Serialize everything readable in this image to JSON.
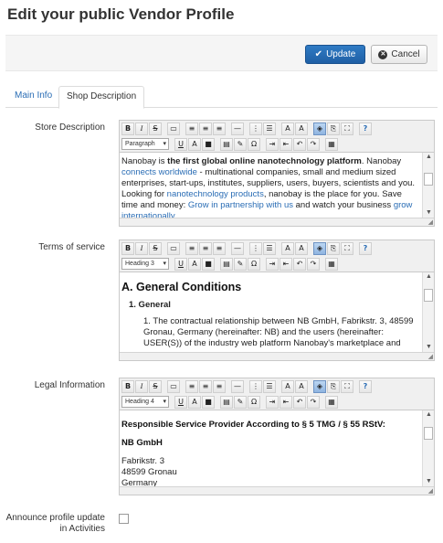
{
  "page": {
    "title": "Edit your public Vendor Profile"
  },
  "actions": {
    "update_label": "Update",
    "cancel_label": "Cancel"
  },
  "tabs": [
    {
      "label": "Main Info"
    },
    {
      "label": "Shop Description"
    }
  ],
  "fields": {
    "store_description": {
      "label": "Store Description",
      "format": "Paragraph",
      "text": {
        "p1_a": "Nanobay is ",
        "p1_b": "the first global online nanotechnology platform",
        "p1_c": ". Nanobay ",
        "link1": "connects worldwide",
        "p1_d": " - multinational companies, small and medium sized enterprises, start-ups, institutes, suppliers, users, buyers, scientists and you. Looking for ",
        "link2": "nanotechnology products",
        "p1_e": ", nanobay is the place for you. Save time and money: ",
        "link3": "Grow in partnership with us",
        "p1_f": " and watch your business ",
        "p1_g": "grow internationally"
      }
    },
    "terms": {
      "label": "Terms of service",
      "format": "Heading 3",
      "heading": "A. General Conditions",
      "item1": "1. General",
      "item2": "1. The contractual relationship between NB GmbH, Fabrikstr. 3, 48599 Gronau, Germany (hereinafter: NB) and the users (hereinafter: USER(S)) of the industry web platform Nanobay's marketplace and"
    },
    "legal": {
      "label": "Legal Information",
      "format": "Heading 4",
      "heading": "Responsible Service Provider According to § 5 TMG / § 55 RStV:",
      "company": "NB GmbH",
      "street": "Fabrikstr. 3",
      "city": "48599 Gronau",
      "country": "Germany"
    },
    "announce": {
      "label_line1": "Announce profile update",
      "label_line2": "in Activities",
      "checked": false
    }
  },
  "icons": [
    "check-icon",
    "cancel-icon",
    "bold-icon",
    "italic-icon",
    "strikethrough-icon",
    "align-left-icon",
    "align-center-icon",
    "align-right-icon",
    "numbered-list-icon",
    "bullet-list-icon",
    "help-icon"
  ],
  "colors": {
    "primary": "#2f7bc4",
    "link": "#2a6db5"
  }
}
